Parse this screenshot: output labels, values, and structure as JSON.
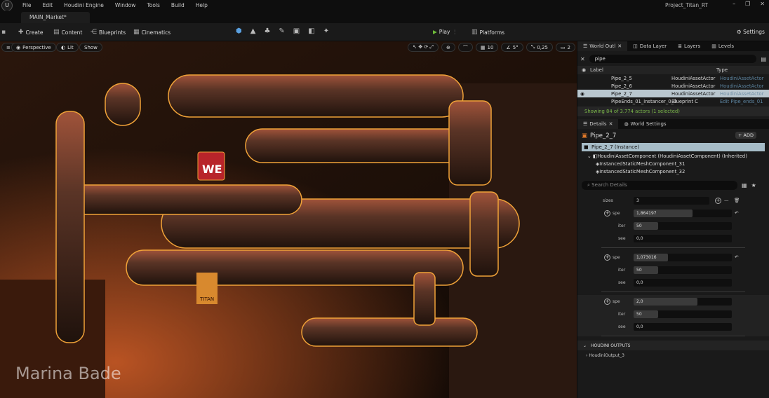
{
  "menubar": {
    "items": [
      "File",
      "Edit",
      "Houdini Engine",
      "Window",
      "Tools",
      "Build",
      "Help"
    ],
    "project": "Project_Titan_RT"
  },
  "tab": {
    "label": "MAIN_Market*"
  },
  "toolbar": {
    "create": "Create",
    "content": "Content",
    "blueprints": "Blueprints",
    "cinematics": "Cinematics",
    "play": "Play",
    "platforms": "Platforms",
    "settings": "Settings"
  },
  "viewport": {
    "perspective": "Perspective",
    "lit": "Lit",
    "show": "Show",
    "grid": "10",
    "angle": "5°",
    "scale": "0,25",
    "cams": "2",
    "sign_top": "WE",
    "sign_bottom": "TITAN"
  },
  "watermark": "Marina Bade",
  "outliner": {
    "tabs": [
      "World Outl",
      "Data Layer",
      "Layers",
      "Levels"
    ],
    "search": "pipe",
    "col_label": "Label",
    "col_type": "Type",
    "rows": [
      {
        "label": "Pipe_2_5",
        "actor": "HoudiniAssetActor",
        "type": "HoudiniAssetActor"
      },
      {
        "label": "Pipe_2_6",
        "actor": "HoudiniAssetActor",
        "type": "HoudiniAssetActor"
      },
      {
        "label": "Pipe_2_7",
        "actor": "HoudiniAssetActor",
        "type": "HoudiniAssetActor"
      },
      {
        "label": "PipeEnds_01_instancer_0_0",
        "actor": "Blueprint C",
        "type": "Edit Pipe_ends_01"
      }
    ],
    "status": "Showing 84 of 3.774 actors (1 selected)"
  },
  "details": {
    "tabs": [
      "Details",
      "World Settings"
    ],
    "actor": "Pipe_2_7",
    "add": "+ ADD",
    "instance": "Pipe_2_7 (Instance)",
    "tree": [
      "HoudiniAssetComponent (HoudiniAssetComponent) (Inherited)",
      "InstancedStaticMeshComponent_31",
      "InstancedStaticMeshComponent_32"
    ],
    "search_placeholder": "Search Details",
    "sizes_label": "sizes",
    "sizes_value": "3",
    "groups": [
      {
        "spe_label": "spe",
        "spe": "1,864197",
        "spe_frac": 0.6,
        "iter_label": "iter",
        "iter": "50",
        "iter_frac": 0.25,
        "see_label": "see",
        "see": "0,0"
      },
      {
        "spe_label": "spe",
        "spe": "1,073016",
        "spe_frac": 0.35,
        "iter_label": "iter",
        "iter": "50",
        "iter_frac": 0.25,
        "see_label": "see",
        "see": "0,0"
      },
      {
        "spe_label": "spe",
        "spe": "2,0",
        "spe_frac": 0.65,
        "iter_label": "iter",
        "iter": "50",
        "iter_frac": 0.25,
        "see_label": "see",
        "see": "0,0"
      }
    ],
    "outputs": "HOUDINI OUTPUTS",
    "output_item": "HoudiniOutput_3"
  },
  "colors": {
    "selection_outline": "#f0a238",
    "accent_green": "#6fbf3a",
    "selected_row": "#b9c7cf"
  }
}
